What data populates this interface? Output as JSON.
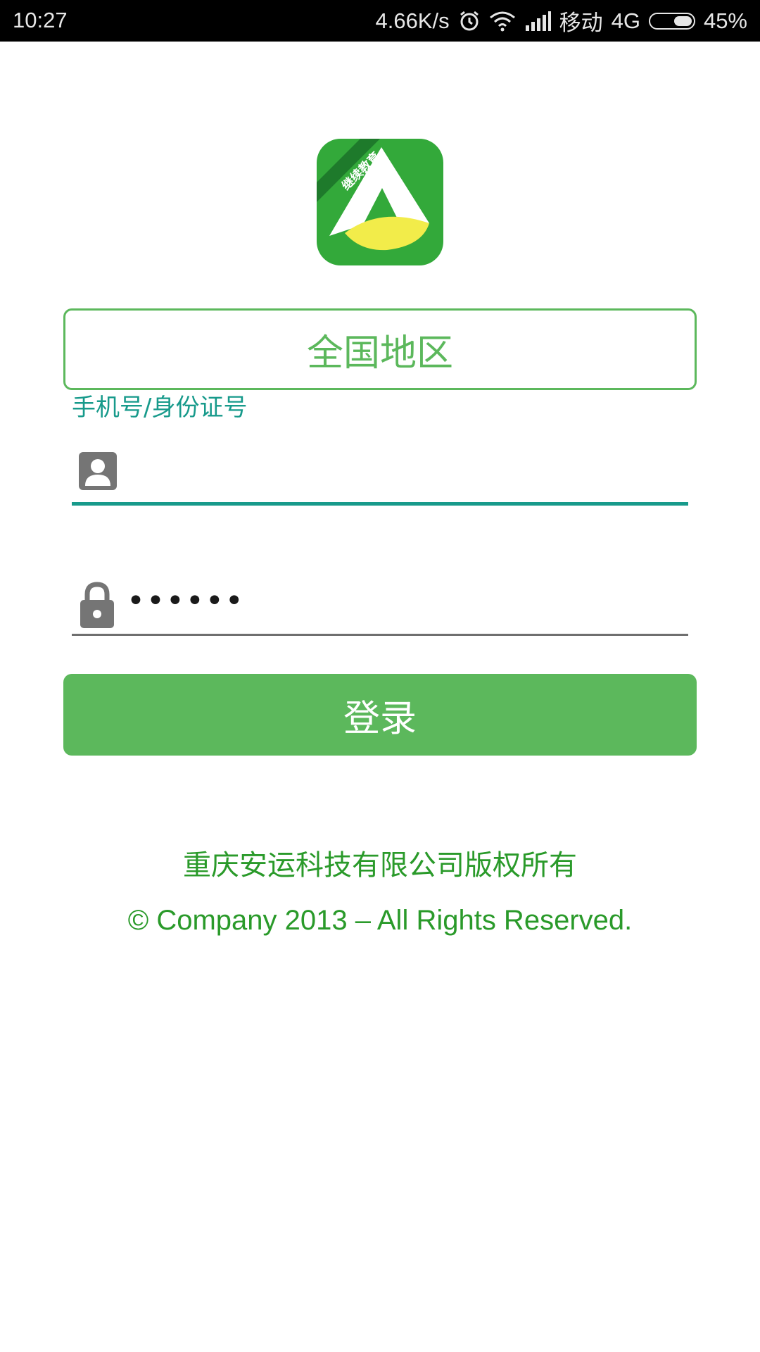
{
  "status_bar": {
    "time": "10:27",
    "net_speed": "4.66K/s",
    "carrier": "移动",
    "network": "4G",
    "battery": "45%",
    "battery_level": 0.45
  },
  "logo": {
    "ribbon_text": "继续教育",
    "colors": {
      "background": "#33a93a",
      "mark": "#ffffff",
      "wave": "#f2ec4a",
      "ribbon": "#1e7a2b"
    }
  },
  "region": {
    "label": "全国地区"
  },
  "account": {
    "hint": "手机号/身份证号",
    "value": "",
    "icon": "account-box-icon"
  },
  "password": {
    "masked_value": "••••••",
    "icon": "lock-icon"
  },
  "login": {
    "label": "登录"
  },
  "footer": {
    "copyright_cn": "重庆安运科技有限公司版权所有",
    "copyright_en": "© Company 2013 – All Rights Reserved."
  },
  "colors": {
    "accent_green": "#5cb85c",
    "teal": "#179a8b",
    "footer_green": "#2a9a2a"
  }
}
